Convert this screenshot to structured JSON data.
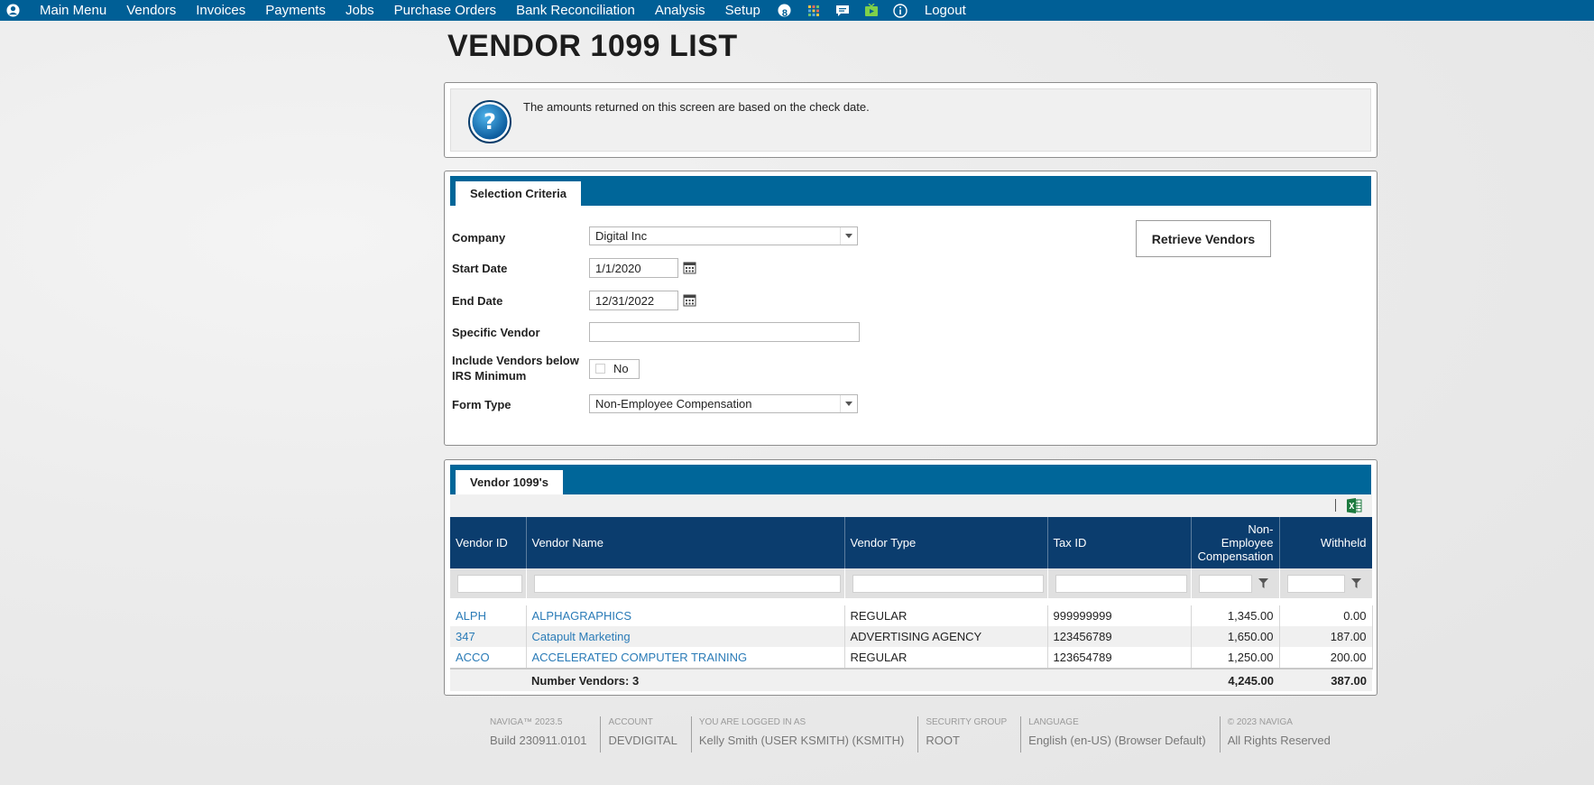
{
  "nav": {
    "items": [
      "Main Menu",
      "Vendors",
      "Invoices",
      "Payments",
      "Jobs",
      "Purchase Orders",
      "Bank Reconciliation",
      "Analysis",
      "Setup"
    ],
    "badge_count": "8",
    "logout": "Logout",
    "icons": [
      "user-icon",
      "badge-icon",
      "apps-grid-icon",
      "chat-icon",
      "video-icon",
      "info-icon"
    ]
  },
  "page": {
    "title": "VENDOR 1099 LIST"
  },
  "info": {
    "message": "The amounts returned on this screen are based on the check date."
  },
  "selection": {
    "tab_label": "Selection Criteria",
    "company_label": "Company",
    "company_value": "Digital Inc",
    "start_label": "Start Date",
    "start_value": "1/1/2020",
    "end_label": "End Date",
    "end_value": "12/31/2022",
    "vendor_label": "Specific Vendor",
    "vendor_value": "",
    "include_label_1": "Include Vendors below",
    "include_label_2": "IRS Minimum",
    "include_value": "No",
    "formtype_label": "Form Type",
    "formtype_value": "Non-Employee Compensation",
    "retrieve_label": "Retrieve Vendors"
  },
  "vendors": {
    "tab_label": "Vendor 1099's",
    "columns": {
      "id": "Vendor ID",
      "name": "Vendor Name",
      "type": "Vendor Type",
      "tax": "Tax ID",
      "comp_1": "Non-",
      "comp_2": "Employee",
      "comp_3": "Compensation",
      "withheld": "Withheld"
    },
    "rows": [
      {
        "id": "ALPH",
        "name": "ALPHAGRAPHICS",
        "type": "REGULAR",
        "tax": "999999999",
        "comp": "1,345.00",
        "withheld": "0.00"
      },
      {
        "id": "347",
        "name": "Catapult Marketing",
        "type": "ADVERTISING AGENCY",
        "tax": "123456789",
        "comp": "1,650.00",
        "withheld": "187.00"
      },
      {
        "id": "ACCO",
        "name": "ACCELERATED COMPUTER TRAINING",
        "type": "REGULAR",
        "tax": "123654789",
        "comp": "1,250.00",
        "withheld": "200.00"
      }
    ],
    "totals": {
      "label": "Number Vendors: 3",
      "comp": "4,245.00",
      "withheld": "387.00"
    }
  },
  "footer": [
    {
      "caption": "NAVIGA™ 2023.5",
      "value": "Build 230911.0101"
    },
    {
      "caption": "ACCOUNT",
      "value": "DEVDIGITAL"
    },
    {
      "caption": "YOU ARE LOGGED IN AS",
      "value": "Kelly Smith (USER KSMITH) (KSMITH)"
    },
    {
      "caption": "SECURITY GROUP",
      "value": "ROOT"
    },
    {
      "caption": "LANGUAGE",
      "value": "English (en-US) (Browser Default)"
    },
    {
      "caption": "© 2023 NAVIGA",
      "value": "All Rights Reserved"
    }
  ],
  "colors": {
    "nav_bg": "#005f96",
    "tab_bar": "#006699",
    "grid_header": "#0b3d6e",
    "link": "#2a7bb7",
    "excel": "#1d7a3f"
  }
}
